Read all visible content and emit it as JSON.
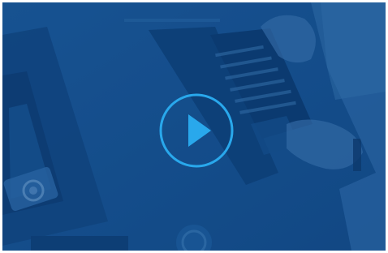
{
  "video_player": {
    "poster_subject": "laptop-desk-photo",
    "play_icon": "play-icon",
    "colors": {
      "overlay": "#14518f",
      "accent": "#29a8ec"
    }
  }
}
